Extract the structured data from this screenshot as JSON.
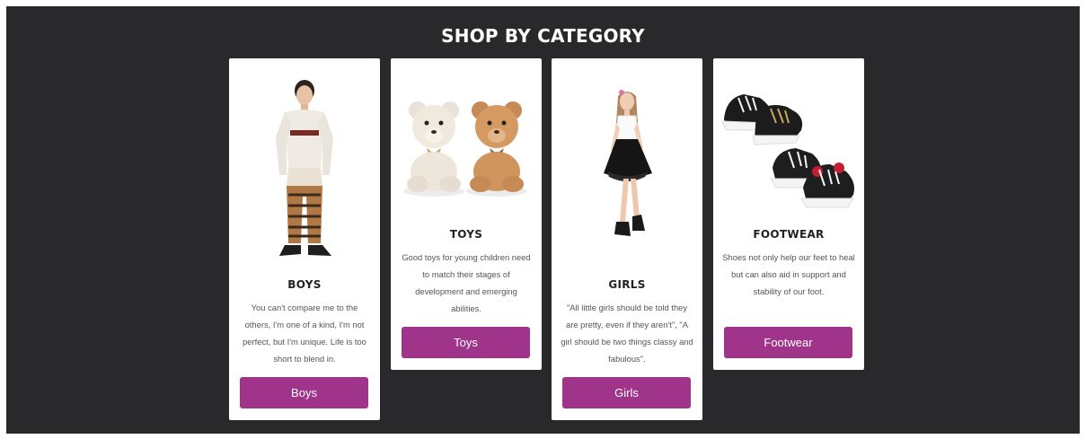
{
  "page": {
    "title": "SHOP BY CATEGORY"
  },
  "categories": [
    {
      "name": "BOYS",
      "description": "You can't compare me to the others, I'm one of a kind, I'm not perfect, but I'm unique. Life is too short to blend in.",
      "button_label": "Boys"
    },
    {
      "name": "TOYS",
      "description": "Good toys for young children need to match their stages of development and emerging abilities.",
      "button_label": "Toys"
    },
    {
      "name": "GIRLS",
      "description": "\"All little girls should be told they are pretty, even if they aren't\", \"A girl should be two things classy and fabulous\".",
      "button_label": "Girls"
    },
    {
      "name": "FOOTWEAR",
      "description": "Shoes not only help our feet to heal but can also aid in support and stability of our foot.",
      "button_label": "Footwear"
    }
  ],
  "colors": {
    "background": "#29282b",
    "card": "#ffffff",
    "button": "#a0338a"
  }
}
